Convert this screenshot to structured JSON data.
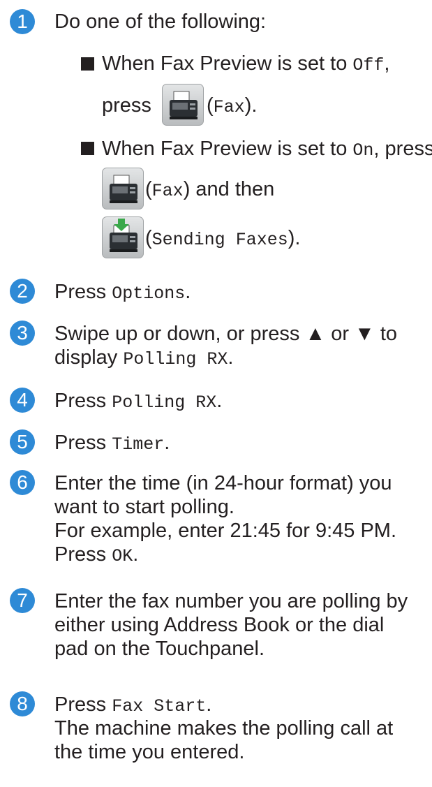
{
  "steps": [
    {
      "number": "1",
      "text": "Do one of the following:"
    },
    {
      "number": "2",
      "prefix": "Press ",
      "code": "Options",
      "suffix": "."
    },
    {
      "number": "3",
      "line1": "Swipe up or down, or press ▲ or ▼ to",
      "line2_prefix": "display ",
      "line2_code": "Polling RX",
      "line2_suffix": "."
    },
    {
      "number": "4",
      "prefix": "Press ",
      "code": "Polling RX",
      "suffix": "."
    },
    {
      "number": "5",
      "prefix": "Press ",
      "code": "Timer",
      "suffix": "."
    },
    {
      "number": "6",
      "line1": "Enter the time (in 24-hour format) you",
      "line2": "want to start polling.",
      "line3": "For example, enter 21:45 for 9:45 PM.",
      "line4_prefix": "Press ",
      "line4_code": "OK",
      "line4_suffix": "."
    },
    {
      "number": "7",
      "line1": "Enter the fax number you are polling by",
      "line2": "either using Address Book or the dial",
      "line3": "pad on the Touchpanel."
    },
    {
      "number": "8",
      "prefix": "Press ",
      "code": "Fax Start",
      "suffix": ".",
      "line2": "The machine makes the polling call at",
      "line3": "the time you entered."
    }
  ],
  "bullets": [
    {
      "prefix": "When Fax Preview is set to ",
      "code": "Off",
      "suffix": ",",
      "press": "press",
      "icon_label_open": " (",
      "icon_code": "Fax",
      "icon_label_close": ")."
    },
    {
      "prefix": "When Fax Preview is set to ",
      "code": "On",
      "suffix": ", press",
      "icon1_open": " (",
      "icon1_code": "Fax",
      "icon1_close": ") and then",
      "icon2_open": " (",
      "icon2_code": "Sending Faxes",
      "icon2_close": ")."
    }
  ],
  "icons": {
    "fax": "fax-icon",
    "send": "sending-faxes-icon"
  },
  "colors": {
    "accent": "#2e8ad6",
    "text": "#231f20"
  }
}
